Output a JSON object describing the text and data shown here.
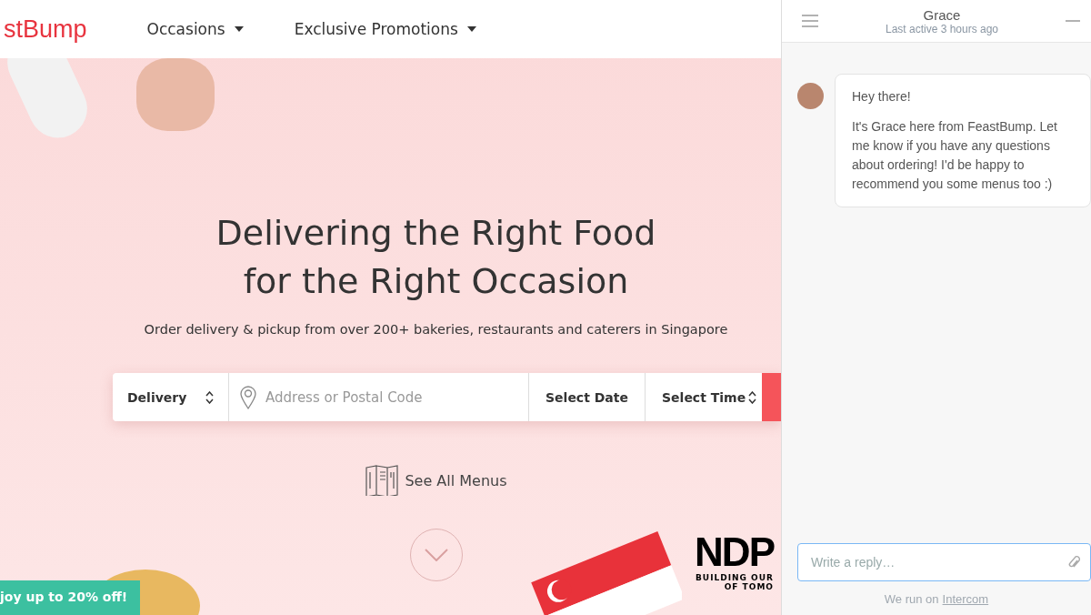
{
  "header": {
    "logo": "stBump",
    "nav": [
      {
        "label": "Occasions"
      },
      {
        "label": "Exclusive Promotions"
      }
    ]
  },
  "hero": {
    "title_lines": [
      "Delivering the Right Food",
      "for the Right Occasion"
    ],
    "subtitle": "Order delivery & pickup from over 200+ bakeries, restaurants and caterers in Singapore"
  },
  "search": {
    "mode": "Delivery",
    "address_placeholder": "Address or Postal Code",
    "date": "Select Date",
    "time": "Select Time"
  },
  "see_all": "See All Menus",
  "promo": "joy up to 20% off!",
  "ndp": {
    "title": "NDP",
    "lines": [
      "BUILDING OUR",
      "OF TOMO"
    ]
  },
  "chat": {
    "name": "Grace",
    "status": "Last active 3 hours ago",
    "messages": [
      "Hey there!",
      "It's Grace here from FeastBump. Let me know if you have any questions about ordering! I'd be happy to recommend you some menus too :)"
    ],
    "reply_placeholder": "Write a reply…",
    "footer": "We run on",
    "footer_link": "Intercom"
  }
}
